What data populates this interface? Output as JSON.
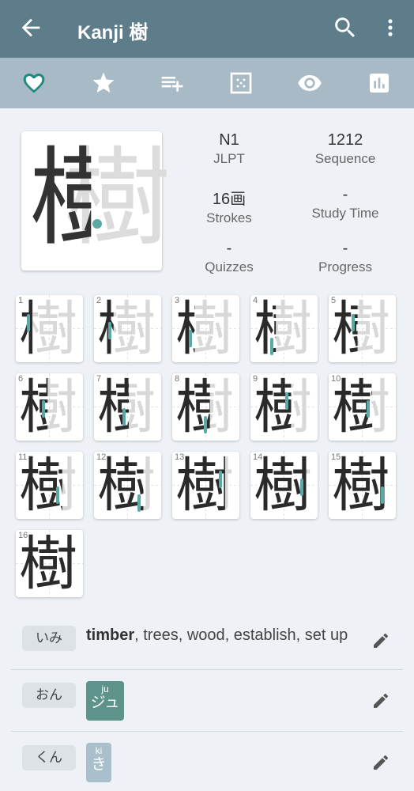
{
  "appbar": {
    "title": "Kanji 樹"
  },
  "toolbar": {
    "icons": [
      "heart-icon",
      "star-icon",
      "add-to-list-icon",
      "grid-icon",
      "eye-icon",
      "chart-icon"
    ]
  },
  "kanji": {
    "character": "樹"
  },
  "stats": [
    {
      "value": "N1",
      "label": "JLPT"
    },
    {
      "value": "1212",
      "label": "Sequence"
    },
    {
      "value": "16画",
      "label": "Strokes"
    },
    {
      "value": "-",
      "label": "Study Time"
    },
    {
      "value": "-",
      "label": "Quizzes"
    },
    {
      "value": "-",
      "label": "Progress"
    }
  ],
  "strokes": {
    "numbers": [
      "1",
      "2",
      "3",
      "4",
      "5",
      "6",
      "7",
      "8",
      "9",
      "10",
      "11",
      "12",
      "13",
      "14",
      "15",
      "16"
    ]
  },
  "meaning": {
    "chip": "いみ",
    "bold": "timber",
    "rest": ", trees, wood, establish, set up"
  },
  "on": {
    "chip": "おん",
    "romaji": "ju",
    "kana": "ジュ"
  },
  "kun": {
    "chip": "くん",
    "romaji": "ki",
    "kana": "き"
  },
  "colors": {
    "appbar": "#5d7d8b",
    "toolbar": "#a7bac5",
    "accent": "#5aa9a6",
    "on_chip": "#5e938b",
    "kun_chip": "#a9bfcb"
  }
}
